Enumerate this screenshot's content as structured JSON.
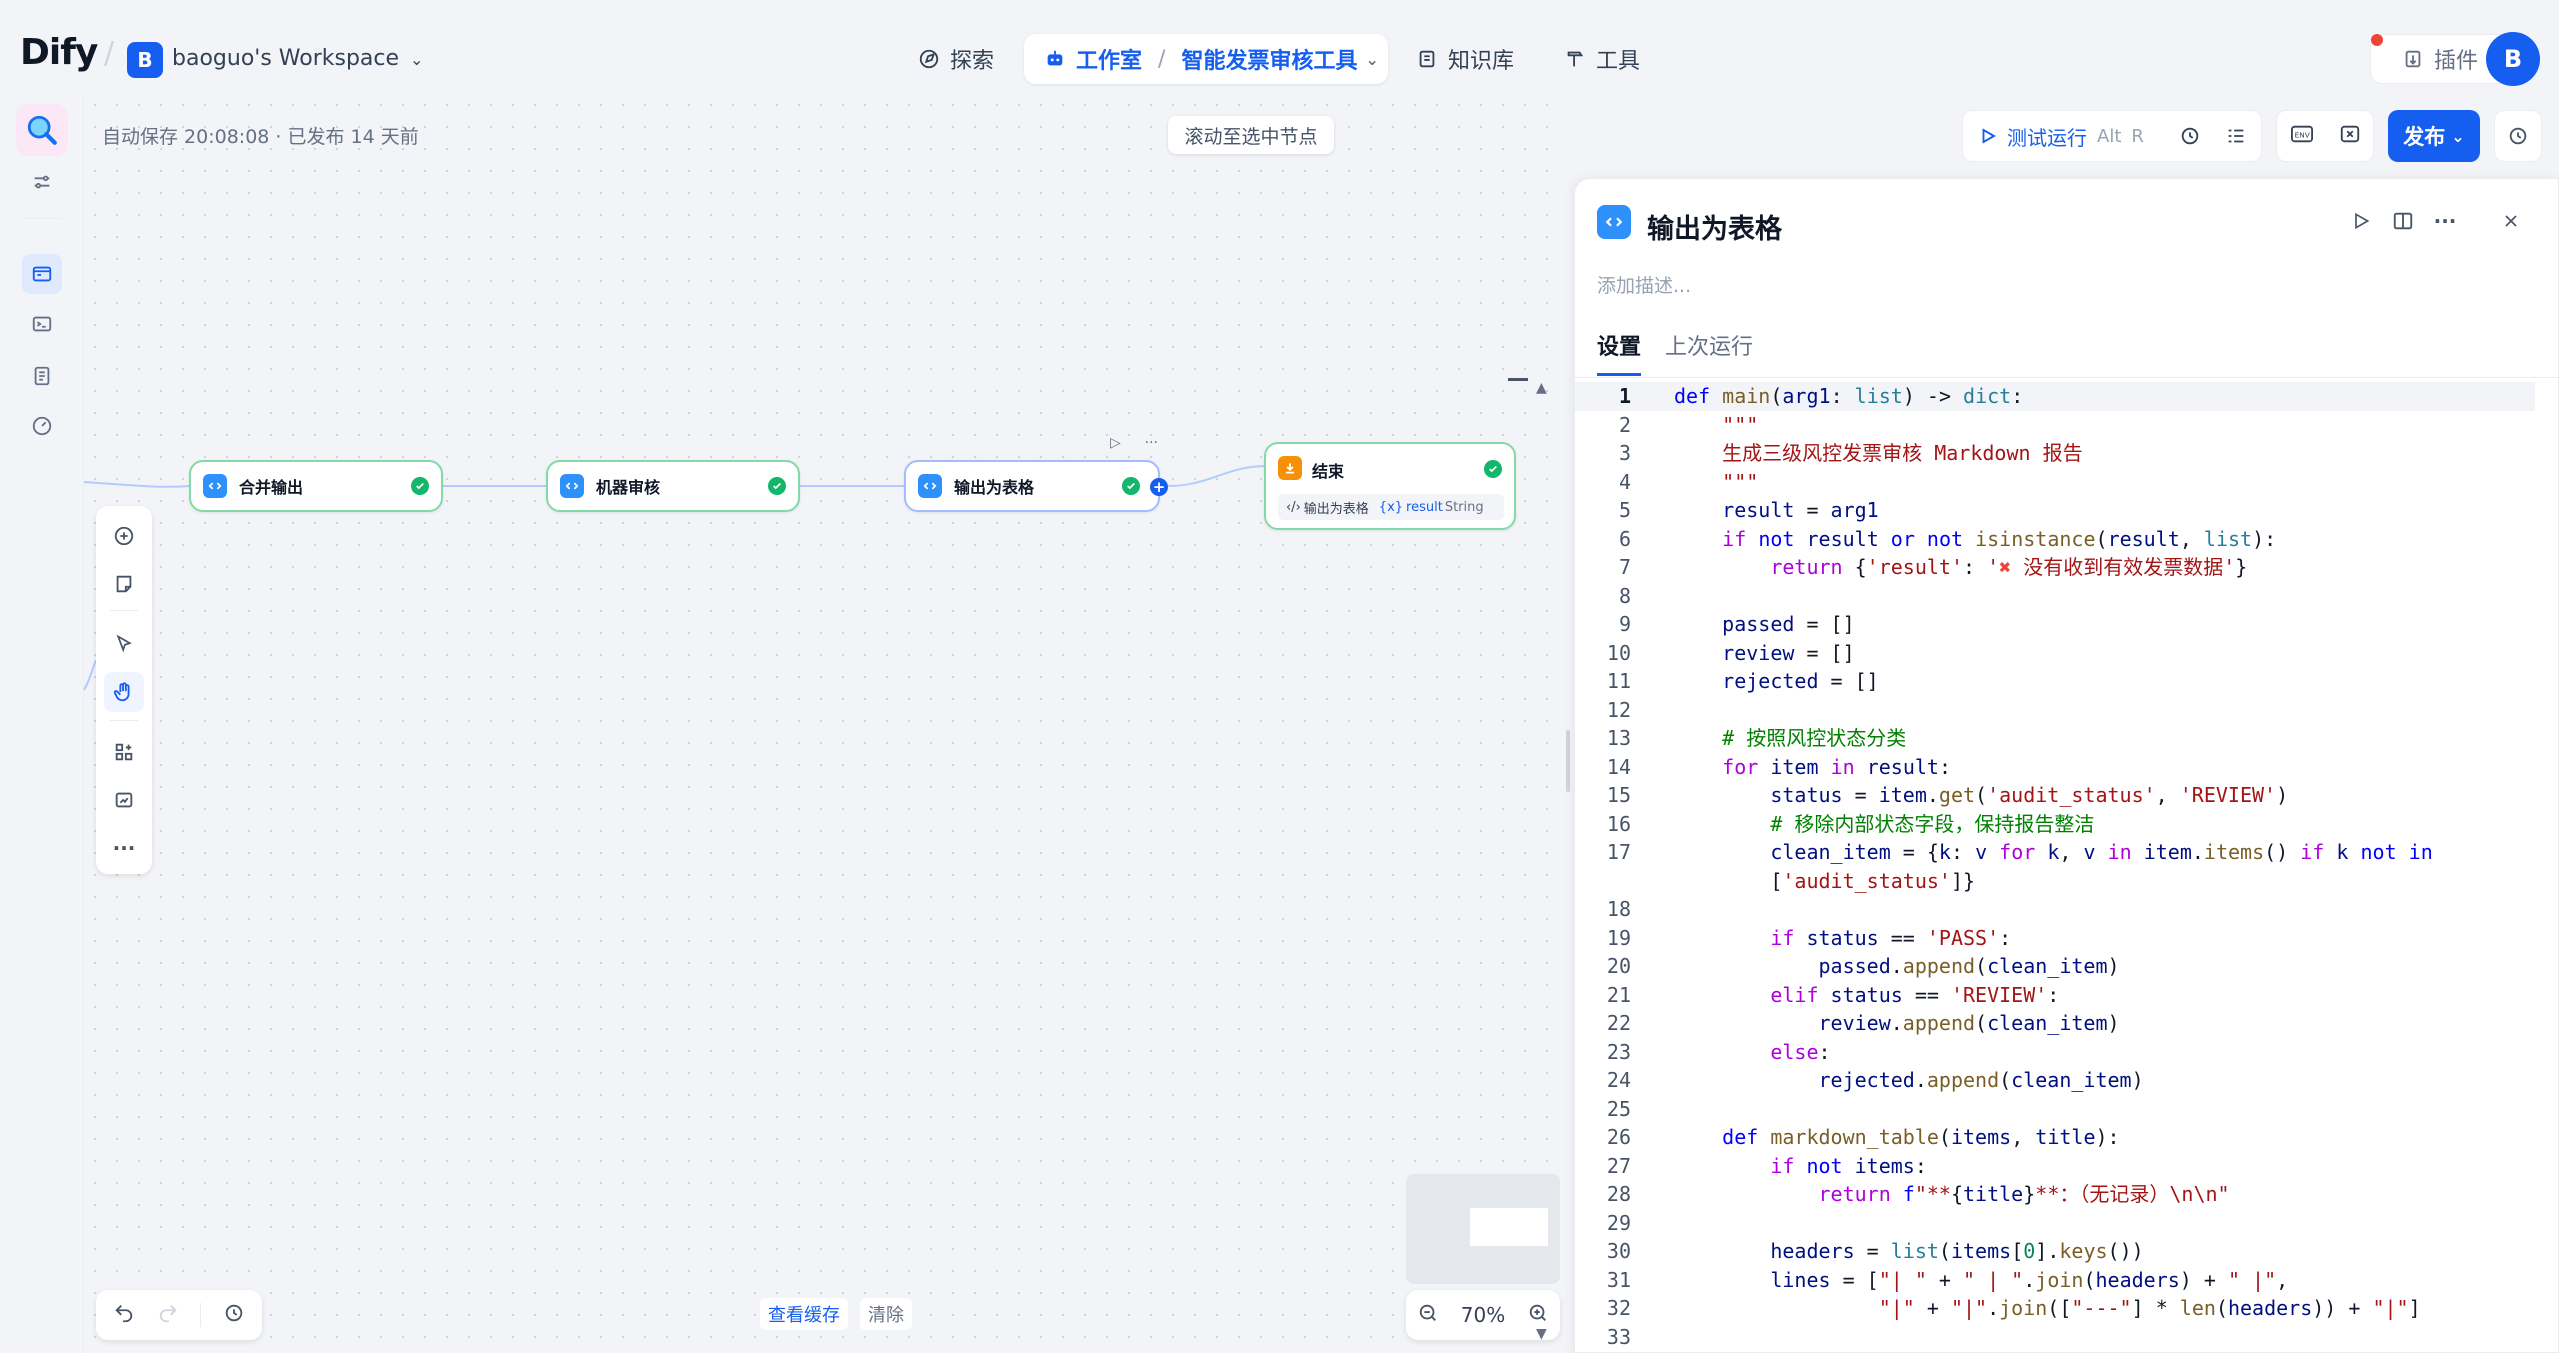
{
  "header": {
    "logo_text": "Dify",
    "workspace_initial": "B",
    "workspace_name": "baoguo's Workspace",
    "nav": {
      "explore": "探索",
      "studio": "工作室",
      "app_name": "智能发票审核工具",
      "knowledge": "知识库",
      "tools": "工具"
    },
    "plugin_label": "插件",
    "avatar_initial": "B"
  },
  "canvas": {
    "autosave_text": "自动保存 20:08:08 · 已发布 14 天前",
    "scroll_to_node": "滚动至选中节点",
    "run_button": "测试运行",
    "run_shortcut_1": "Alt",
    "run_shortcut_2": "R",
    "publish": "发布",
    "nodes": {
      "merge_output": "合并输出",
      "machine_review": "机器审核",
      "output_table": "输出为表格",
      "end": "结束"
    },
    "end_var": {
      "source": "输出为表格",
      "var_prefix": "{x}",
      "var_name": "result",
      "var_type": "String"
    },
    "view_cache": "查看缓存",
    "clear": "清除",
    "zoom": "70%"
  },
  "panel": {
    "title": "输出为表格",
    "description_placeholder": "添加描述...",
    "tabs": [
      "设置",
      "上次运行"
    ],
    "line_numbers": [
      "1",
      "2",
      "3",
      "4",
      "5",
      "6",
      "7",
      "8",
      "9",
      "10",
      "11",
      "12",
      "13",
      "14",
      "15",
      "16",
      "17",
      "",
      "18",
      "19",
      "20",
      "21",
      "22",
      "23",
      "24",
      "25",
      "26",
      "27",
      "28",
      "29",
      "30",
      "31",
      "32",
      "33"
    ]
  },
  "colors": {
    "accent": "#155eef",
    "success": "#12b76a",
    "end_node": "#f79009",
    "code_node": "#2e90fa"
  }
}
